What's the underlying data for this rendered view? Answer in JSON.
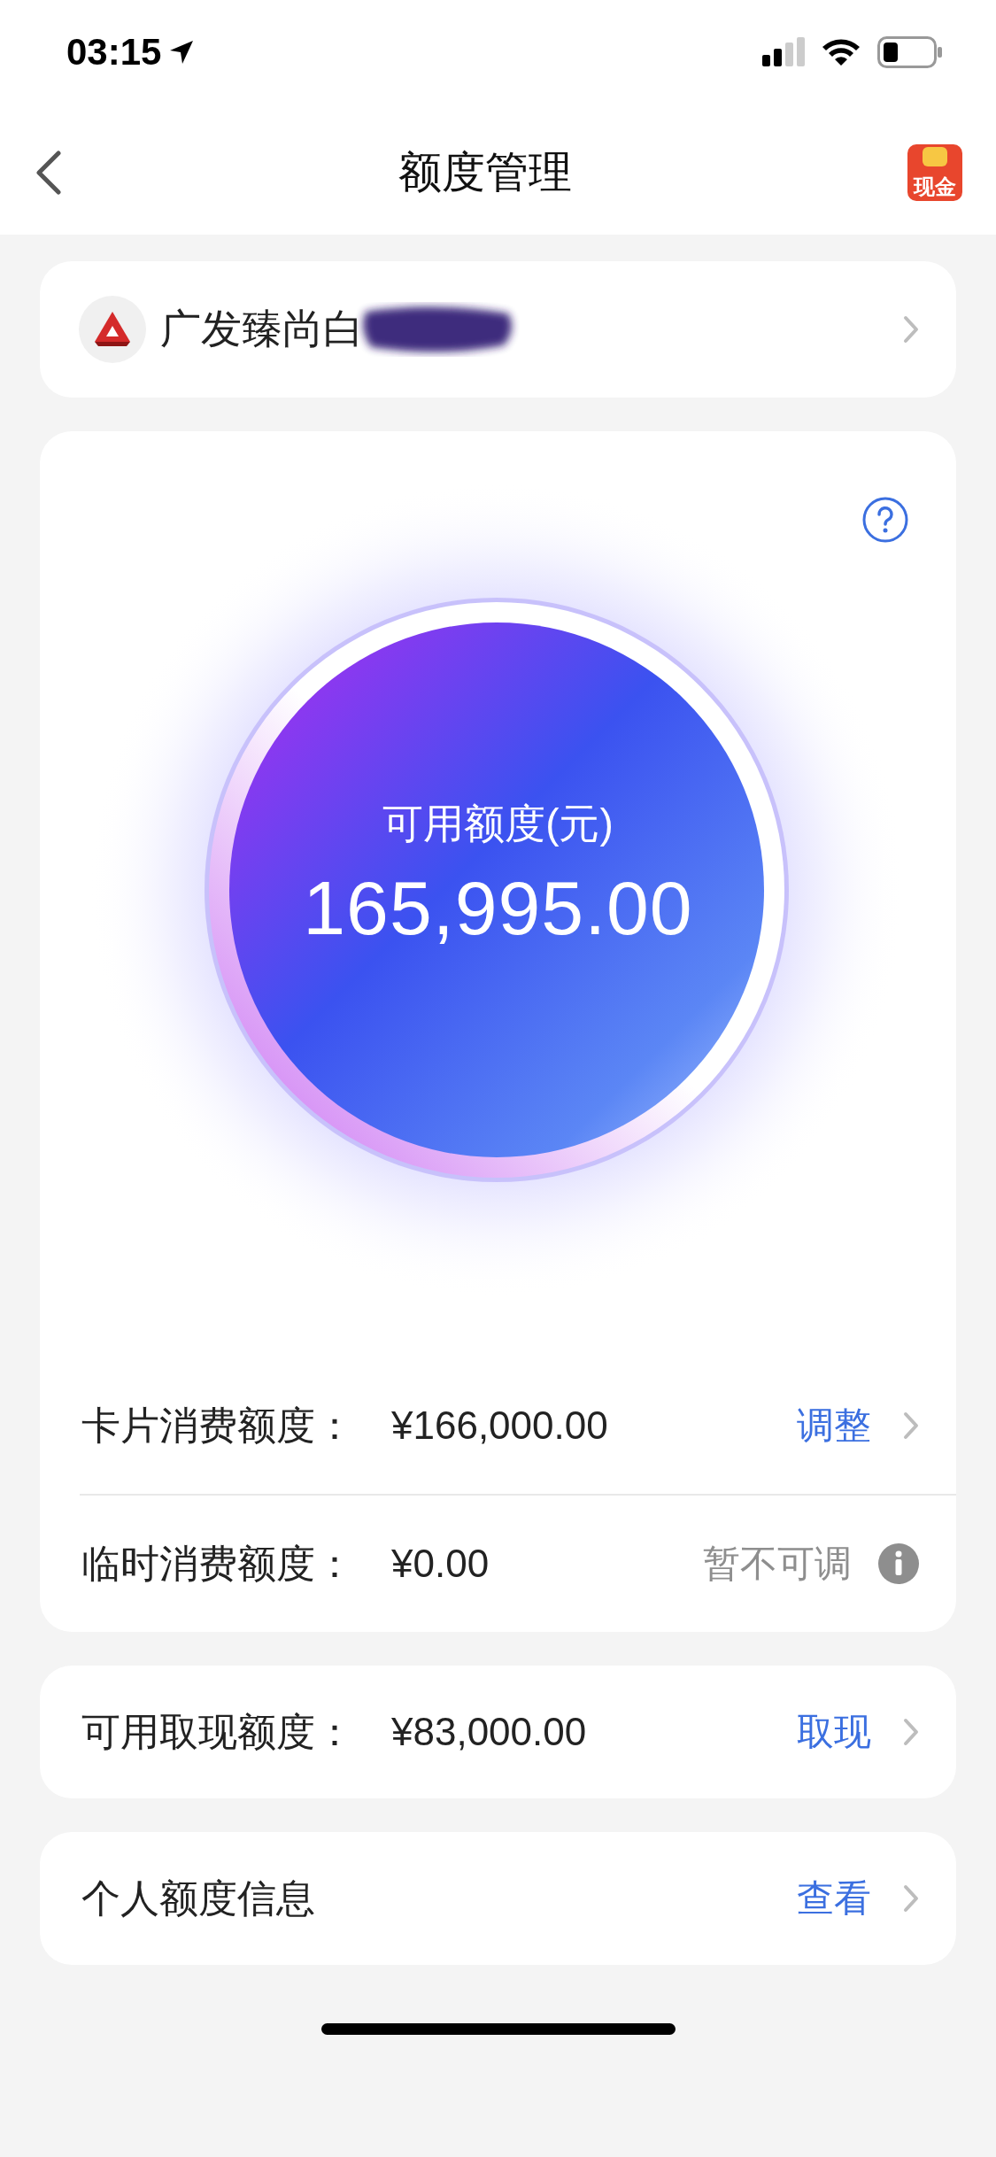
{
  "status_bar": {
    "time": "03:15"
  },
  "nav": {
    "title": "额度管理",
    "cash_badge": "现金"
  },
  "card_selector": {
    "name": "广发臻尚白",
    "redacted": true
  },
  "available": {
    "label": "可用额度(元)",
    "amount": "165,995.00"
  },
  "limit_rows": [
    {
      "label": "卡片消费额度：",
      "amount": "¥166,000.00",
      "action": "调整",
      "kind": "link"
    },
    {
      "label": "临时消费额度：",
      "amount": "¥0.00",
      "action": "暂不可调",
      "kind": "info"
    }
  ],
  "sections": [
    {
      "label": "可用取现额度：",
      "amount": "¥83,000.00",
      "action": "取现"
    },
    {
      "label": "个人额度信息",
      "action": "查看"
    }
  ]
}
